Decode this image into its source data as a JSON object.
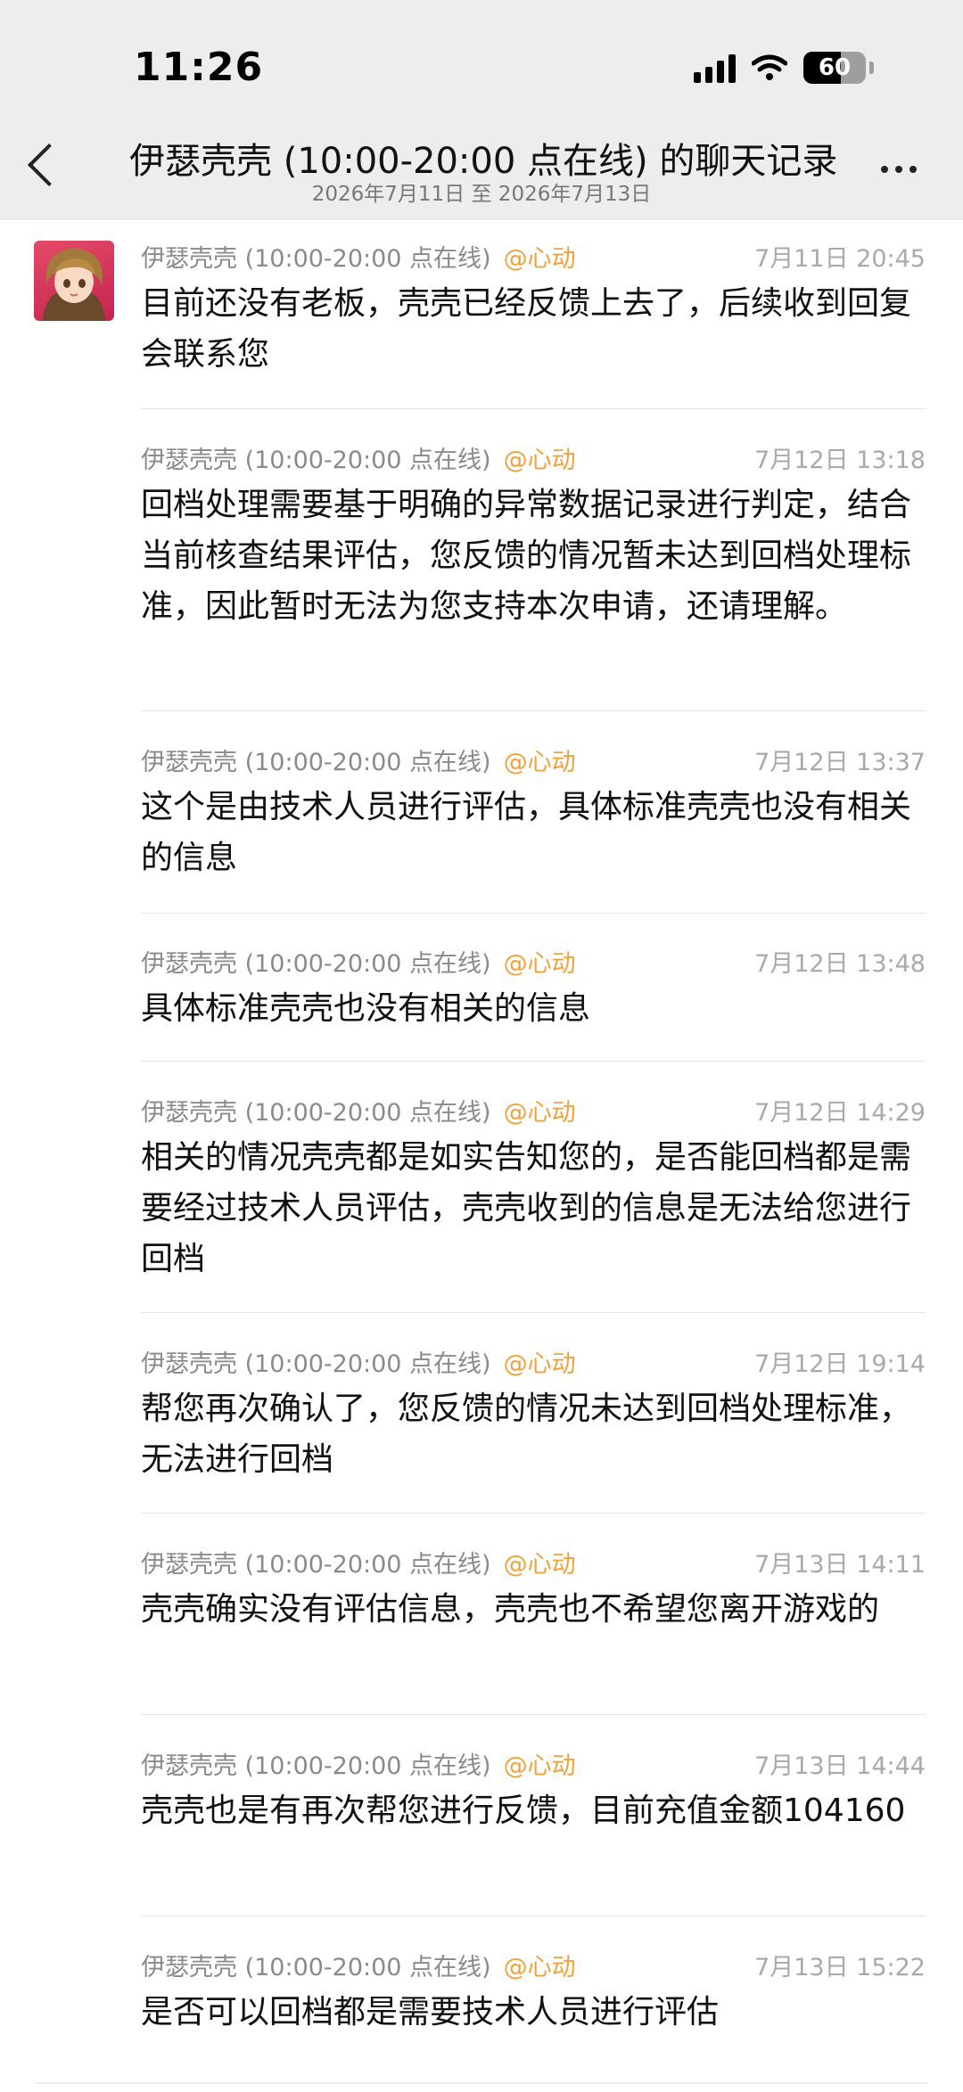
{
  "status_bar": {
    "time": "11:26",
    "battery": "60",
    "battery_level": 0.6
  },
  "header": {
    "title": "伊瑟壳壳 (10:00-20:00 点在线) 的聊天记录",
    "subtitle": "2026年7月11日 至 2026年7月13日"
  },
  "messages": [
    {
      "sender": "伊瑟壳壳 (10:00-20:00 点在线)",
      "tag": "@心动",
      "time": "7月11日 20:45",
      "text": "目前还没有老板，壳壳已经反馈上去了，后续收到回复会联系您"
    },
    {
      "sender": "伊瑟壳壳 (10:00-20:00 点在线)",
      "tag": "@心动",
      "time": "7月12日 13:18",
      "text": "回档处理需要基于明确的异常数据记录进行判定，结合当前核查结果评估，您反馈的情况暂未达到回档处理标准，因此暂时无法为您支持本次申请，还请理解。"
    },
    {
      "sender": "伊瑟壳壳 (10:00-20:00 点在线)",
      "tag": "@心动",
      "time": "7月12日 13:37",
      "text": "这个是由技术人员进行评估，具体标准壳壳也没有相关的信息"
    },
    {
      "sender": "伊瑟壳壳 (10:00-20:00 点在线)",
      "tag": "@心动",
      "time": "7月12日 13:48",
      "text": "具体标准壳壳也没有相关的信息"
    },
    {
      "sender": "伊瑟壳壳 (10:00-20:00 点在线)",
      "tag": "@心动",
      "time": "7月12日 14:29",
      "text": "相关的情况壳壳都是如实告知您的，是否能回档都是需要经过技术人员评估，壳壳收到的信息是无法给您进行回档"
    },
    {
      "sender": "伊瑟壳壳 (10:00-20:00 点在线)",
      "tag": "@心动",
      "time": "7月12日 19:14",
      "text": "帮您再次确认了，您反馈的情况未达到回档处理标准，无法进行回档"
    },
    {
      "sender": "伊瑟壳壳 (10:00-20:00 点在线)",
      "tag": "@心动",
      "time": "7月13日 14:11",
      "text": "壳壳确实没有评估信息，壳壳也不希望您离开游戏的"
    },
    {
      "sender": "伊瑟壳壳 (10:00-20:00 点在线)",
      "tag": "@心动",
      "time": "7月13日 14:44",
      "text": "壳壳也是有再次帮您进行反馈，目前充值金额104160"
    },
    {
      "sender": "伊瑟壳壳 (10:00-20:00 点在线)",
      "tag": "@心动",
      "time": "7月13日 15:22",
      "text": "是否可以回档都是需要技术人员进行评估"
    }
  ]
}
